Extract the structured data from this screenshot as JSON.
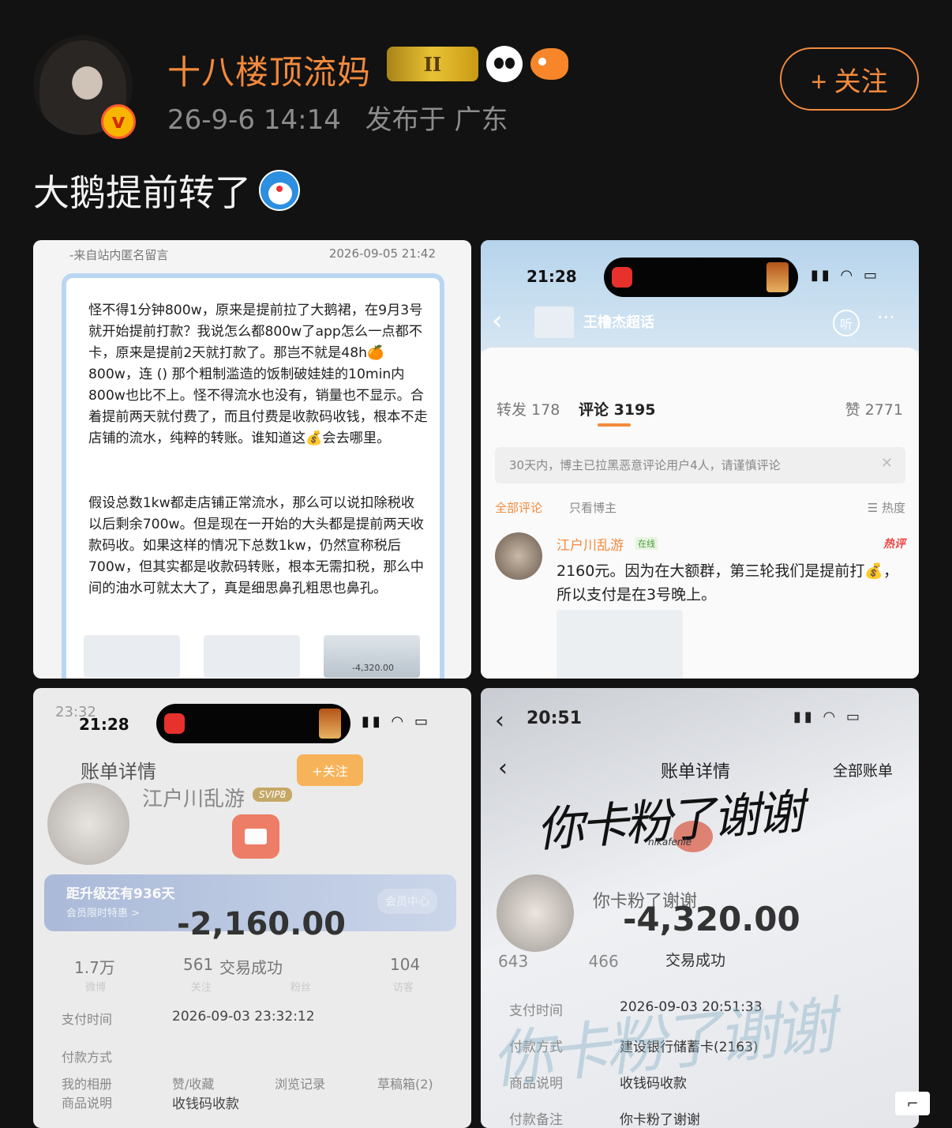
{
  "header": {
    "username": "十八楼顶流妈",
    "level_badge": "II",
    "date": "26-9-6 14:14",
    "location": "发布于 广东",
    "follow_label": "+ 关注",
    "verified_mark": "v"
  },
  "post": {
    "text": "大鹅提前转了"
  },
  "tile1": {
    "source": "-来自站内匿名留言",
    "date": "2026-09-05 21:42",
    "para1": "怪不得1分钟800w，原来是提前拉了大鹅裙，在9月3号就开始提前打款？我说怎么都800w了app怎么一点都不卡，原来是提前2天就打款了。那岂不就是48h🍊800w，连 () 那个粗制滥造的饭制破娃娃的10min内800w也比不上。怪不得流水也没有，销量也不显示。合着提前两天就付费了，而且付费是收款码收钱，根本不走店铺的流水，纯粹的转账。谁知道这💰会去哪里。",
    "para2": "假设总数1kw都走店铺正常流水，那么可以说扣除税收以后剩余700w。但是现在一开始的大头都是提前两天收款码收。如果这样的情况下总数1kw，仍然宣称税后700w，但其实都是收款码转账，根本无需扣税，那么中间的油水可就太大了，真是细思鼻孔粗思也鼻孔。",
    "thumb_amount": "-4,320.00"
  },
  "tile2": {
    "time": "21:28",
    "topic": "王橹杰超话",
    "listen": "听",
    "more": "···",
    "tabs": {
      "repost": "转发 178",
      "comments": "评论 3195",
      "likes": "赞 2771"
    },
    "warning": "30天内，博主已拉黑恶意评论用户4人，请谨慎评论",
    "filter": {
      "all": "全部评论",
      "author_only": "只看博主",
      "sort": "☰ 热度"
    },
    "comment": {
      "name": "江户川乱游",
      "online": "在线",
      "hot": "热评",
      "text": "2160元。因为在大额群，第三轮我们是提前打💰，所以支付是在3号晚上。"
    }
  },
  "tile3": {
    "time_back": "23:32",
    "time": "21:28",
    "title": "账单详情",
    "name": "江户川乱游",
    "svip": "SVIP8",
    "follow": "+关注",
    "upgrade": "距升级还有936天",
    "upgrade_sub": "会员限时特惠 >",
    "vip_center": "会员中心",
    "amount": "-2,160.00",
    "stats": [
      {
        "value": "1.7万",
        "label": "微博"
      },
      {
        "value": "561",
        "label": "关注"
      },
      {
        "value": "交易成功",
        "label": "粉丝"
      },
      {
        "value": "104",
        "label": "访客"
      }
    ],
    "pay_time_label": "支付时间",
    "pay_time": "2026-09-03 23:32:12",
    "pay_method_label": "付款方式",
    "desc_label": "商品说明",
    "desc": "收钱码收款",
    "album": "我的相册",
    "likes": "赞/收藏",
    "history": "浏览记录",
    "drafts": "草稿箱(2)"
  },
  "tile4": {
    "time": "20:51",
    "title": "账单详情",
    "all_bills": "全部账单",
    "script": "你卡粉了谢谢",
    "signature": "nikafenle",
    "nick": "你卡粉了谢谢",
    "amount": "-4,320.00",
    "status": "交易成功",
    "stats": [
      "643",
      "466"
    ],
    "pay_time_label": "支付时间",
    "pay_time": "2026-09-03 20:51:33",
    "pay_method_label": "付款方式",
    "pay_method": "建设银行储蓄卡(2163)",
    "desc_label": "商品说明",
    "desc": "收钱码收款",
    "note_label": "付款备注",
    "note": "你卡粉了谢谢"
  },
  "corner": "⌐"
}
